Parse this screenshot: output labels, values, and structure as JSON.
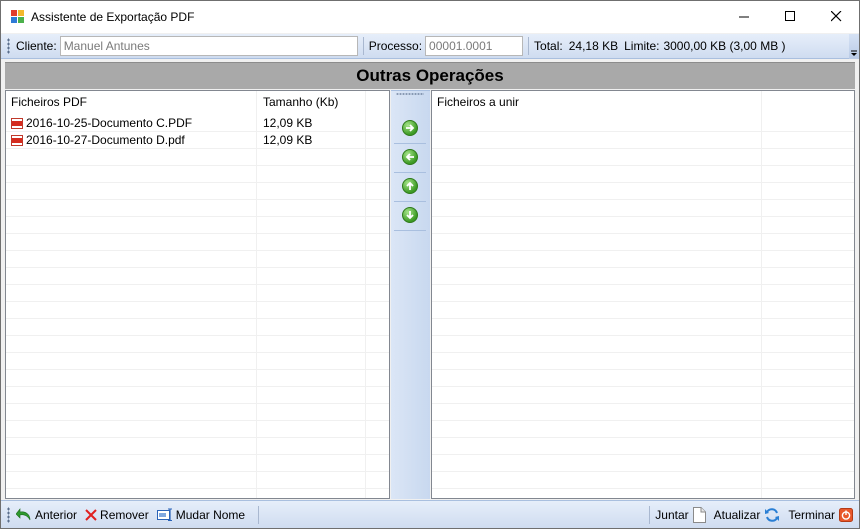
{
  "window": {
    "title": "Assistente de Exportação PDF"
  },
  "toolbar": {
    "client_label": "Cliente:",
    "client_value": "Manuel Antunes",
    "process_label": "Processo:",
    "process_value": "00001.0001",
    "total_label": "Total:",
    "total_value": "24,18 KB",
    "limit_label": "Limite:",
    "limit_value": "3000,00 KB (3,00 MB )"
  },
  "header": {
    "title": "Outras Operações"
  },
  "left_list": {
    "columns": [
      "Ficheiros PDF",
      "Tamanho (Kb)"
    ],
    "rows": [
      {
        "name": "2016-10-25-Documento C.PDF",
        "size": "12,09 KB"
      },
      {
        "name": "2016-10-27-Documento D.pdf",
        "size": "12,09 KB"
      }
    ]
  },
  "right_list": {
    "columns": [
      "Ficheiros a unir"
    ]
  },
  "bottom": {
    "back_label": "Anterior",
    "remove_label": "Remover",
    "rename_label": "Mudar Nome",
    "merge_label": "Juntar",
    "refresh_label": "Atualizar",
    "finish_label": "Terminar"
  },
  "colors": {
    "header_band": "#a9a9a9",
    "toolbar": "#cfdcf0",
    "accent_green": "#3c9a24"
  }
}
